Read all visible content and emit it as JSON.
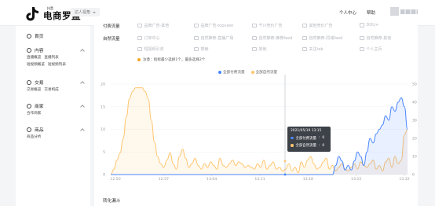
{
  "header": {
    "logo_small": "抖音",
    "logo_text": "电商罗盘",
    "role_select": "达人视角",
    "links": [
      "个人中心",
      "帮助"
    ]
  },
  "sidebar": {
    "groups": [
      {
        "label": "首页",
        "icon": "home-icon",
        "subs": []
      },
      {
        "label": "内容",
        "icon": "content-icon",
        "subs": [
          [
            "直播概览",
            "直播列表"
          ],
          [
            "短视频概览",
            "短视频列表"
          ]
        ]
      },
      {
        "label": "交易",
        "icon": "trade-icon",
        "subs": [
          [
            "交易概览",
            "交易构成"
          ]
        ]
      },
      {
        "label": "商家",
        "icon": "merchant-icon",
        "subs": [
          [
            "合作商家"
          ]
        ]
      },
      {
        "label": "商品",
        "icon": "goods-icon",
        "subs": [
          [
            "商品分析"
          ]
        ]
      }
    ]
  },
  "filters": {
    "paid_label": "付费流量",
    "natural_label": "自然流量",
    "paid_options": [
      "品牌广告-其他",
      "品牌广告-topview",
      "千川竞价广告",
      "其他竞价广告",
      "DOU+"
    ],
    "natural_row1": [
      "订单中心",
      "自然推荐-直播广场",
      "自然推荐-推荐feed",
      "自然推荐-同城feed",
      "自然推荐-其他"
    ],
    "natural_row2": [
      "短视频引流",
      "搜索",
      "其他",
      "关注tab",
      "个人主页"
    ],
    "note": "注意：指标最少选择1个，最多选择2个"
  },
  "chart_data": {
    "type": "line",
    "series": [
      {
        "name": "全部付费流量",
        "color": "#4a86ff",
        "axis": "left"
      },
      {
        "name": "全部自然流量",
        "color": "#ffc56e",
        "axis": "right"
      }
    ],
    "x_ticks": [
      "12:50",
      "12:57",
      "13:04",
      "13:11",
      "13:18",
      "13:25",
      "13:32"
    ],
    "left_axis": {
      "ticks": [
        0,
        5,
        10,
        15,
        20
      ],
      "ylim": [
        0,
        20
      ]
    },
    "right_axis": {
      "ticks": [
        0,
        10,
        20,
        30,
        40,
        50
      ],
      "ylim": [
        0,
        50
      ]
    },
    "x": [
      0,
      1,
      2,
      3,
      4,
      5,
      6,
      7,
      8,
      9,
      10,
      11,
      12,
      13,
      14,
      15,
      16,
      17,
      18,
      19,
      20,
      21,
      22,
      23,
      24,
      25,
      26,
      27,
      28,
      29,
      30,
      31,
      32,
      33,
      34,
      35,
      36,
      37,
      38,
      39,
      40,
      41,
      42,
      43,
      44,
      45,
      46,
      47,
      48,
      49,
      50,
      51,
      52,
      53,
      54,
      55,
      56,
      57,
      58,
      59,
      60,
      61,
      62,
      63,
      64,
      65,
      66,
      67,
      68,
      69,
      70,
      71,
      72,
      73,
      74,
      75,
      76,
      77,
      78,
      79,
      80,
      81,
      82,
      83,
      84,
      85,
      86,
      87,
      88,
      89,
      90,
      91,
      92,
      93,
      94,
      95
    ],
    "paid_values": [
      0,
      0,
      0,
      0,
      0,
      0,
      0,
      0,
      0,
      0,
      0,
      0,
      0,
      0,
      0,
      0,
      0,
      0,
      0,
      0,
      0,
      0,
      0,
      0,
      0,
      0,
      0,
      0,
      0,
      0,
      0,
      0,
      0,
      0,
      0,
      0,
      0,
      0,
      0,
      0,
      0,
      0,
      0,
      0,
      0,
      0,
      0,
      0,
      0,
      0,
      0,
      0,
      0,
      0,
      0,
      0,
      0,
      0,
      0,
      0,
      0,
      0,
      0,
      0,
      0,
      0,
      0,
      0,
      0,
      0,
      0,
      0,
      2,
      4,
      3,
      1,
      2,
      1,
      3,
      5,
      4,
      2,
      5,
      8,
      7,
      9,
      10,
      11,
      13,
      12,
      15,
      14,
      16,
      17,
      15,
      10
    ],
    "natural_values": [
      0,
      3,
      8,
      12,
      20,
      32,
      42,
      46,
      48,
      48,
      48,
      46,
      42,
      30,
      18,
      10,
      6,
      4,
      8,
      12,
      6,
      3,
      10,
      14,
      9,
      4,
      6,
      9,
      5,
      3,
      6,
      4,
      7,
      5,
      3,
      9,
      5,
      4,
      6,
      8,
      5,
      7,
      6,
      4,
      5,
      4,
      3,
      6,
      4,
      8,
      3,
      5,
      7,
      3,
      4,
      2,
      3,
      6,
      2,
      4,
      1,
      7,
      4,
      8,
      10,
      6,
      3,
      4,
      7,
      9,
      3,
      5,
      2,
      4,
      6,
      3,
      2,
      4,
      6,
      3,
      7,
      5,
      4,
      6,
      8,
      3,
      5,
      2,
      7,
      9,
      4,
      10,
      6,
      8,
      22,
      25
    ],
    "tooltip": {
      "time": "2021/05/19 13:15",
      "rows": [
        {
          "label": "全部付费流量",
          "value": "0"
        },
        {
          "label": "全部自然流量",
          "value": "0"
        }
      ]
    }
  },
  "section_title": "转化漏斗",
  "colors": {
    "accent": "#4a86ff",
    "secondary": "#ffc56e"
  }
}
